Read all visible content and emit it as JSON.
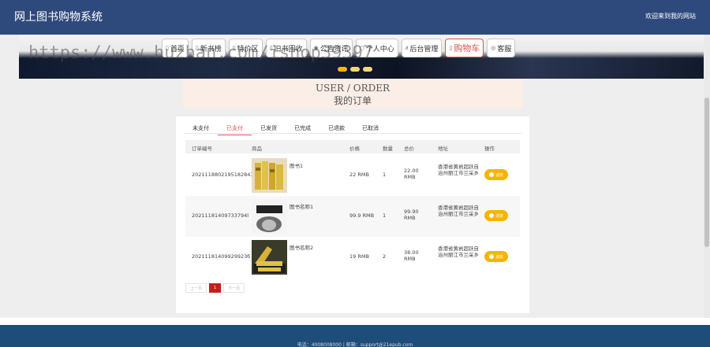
{
  "header": {
    "title": "网上图书购物系统",
    "welcome": "欢迎来到我的网站"
  },
  "watermark": "https://www.huzhan.com/ishop39397",
  "nav": [
    {
      "label": "首页",
      "icon": "home-icon"
    },
    {
      "label": "新书榜",
      "icon": "list-icon"
    },
    {
      "label": "特价区",
      "icon": "tag-icon"
    },
    {
      "label": "旧书回收",
      "icon": "recycle-icon"
    },
    {
      "label": "公告资讯",
      "icon": "megaphone-icon"
    },
    {
      "label": "个人中心",
      "icon": "user-icon"
    },
    {
      "label": "后台管理",
      "icon": "link-icon"
    },
    {
      "label": "购物车",
      "icon": "cart-icon"
    },
    {
      "label": "客服",
      "icon": "support-icon"
    }
  ],
  "page": {
    "title_en": "USER / ORDER",
    "title_cn": "我的订单"
  },
  "tabs": [
    "未支付",
    "已支付",
    "已发货",
    "已完成",
    "已退款",
    "已取消"
  ],
  "active_tab": "已支付",
  "table": {
    "headers": [
      "订单编号",
      "商品",
      "价格",
      "数量",
      "总价",
      "地址",
      "操作"
    ],
    "rows": [
      {
        "order_no": "202111880219518284З",
        "product": "图书1",
        "price": "22 RMB",
        "qty": "1",
        "total": "22.00 RMB",
        "address": "香港省黄岩超跃自治州丽江市兰采乡",
        "op": "退款"
      },
      {
        "order_no": "20211181409733794l",
        "product": "图书名称1",
        "price": "99.9 RMB",
        "qty": "1",
        "total": "99.90 RMB",
        "address": "香港省黄岩超跃自治州丽江市兰采乡",
        "op": "退款"
      },
      {
        "order_no": "20211181409929923б",
        "product": "图书名称2",
        "price": "19 RMB",
        "qty": "2",
        "total": "38.00 RMB",
        "address": "香港省黄岩超跃自治州丽江市兰采乡",
        "op": "退款"
      }
    ]
  },
  "pager": {
    "prev": "上一页",
    "current": "1",
    "next": "下一页"
  },
  "footer": {
    "text": "电话：4008008000 | 邮箱：support@21epub.com"
  },
  "colors": {
    "header": "#2e4a7d",
    "accent": "#d9534f",
    "button": "#f5b400",
    "footer": "#1f4d7a"
  }
}
